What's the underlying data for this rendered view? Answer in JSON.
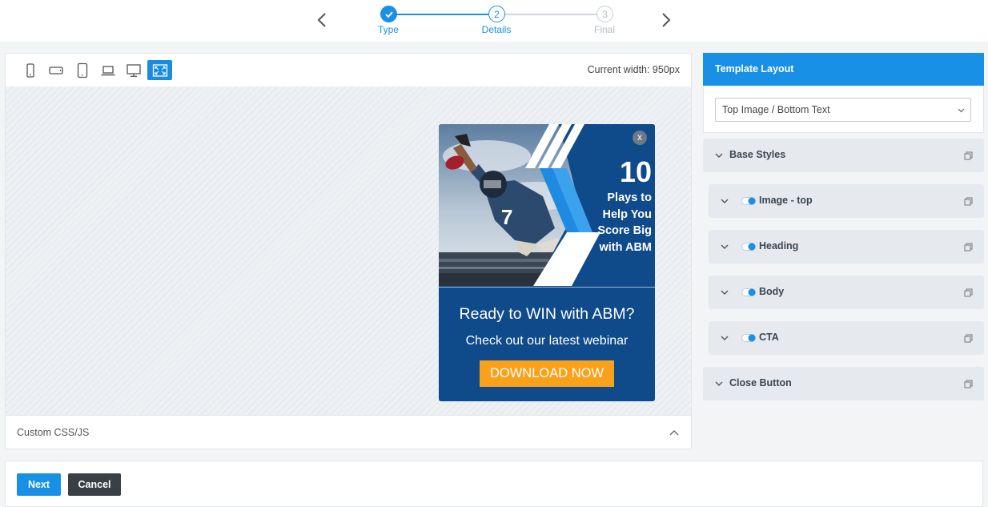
{
  "stepper": {
    "steps": [
      {
        "number": "1",
        "label": "Type",
        "state": "done"
      },
      {
        "number": "2",
        "label": "Details",
        "state": "active"
      },
      {
        "number": "3",
        "label": "Final",
        "state": "upcoming"
      }
    ],
    "prev_icon": "chevron-left-icon",
    "next_icon": "chevron-right-icon"
  },
  "preview": {
    "device_buttons": [
      {
        "name": "mobile-portrait",
        "icon": "mobile-portrait-icon"
      },
      {
        "name": "mobile-landscape",
        "icon": "mobile-landscape-icon"
      },
      {
        "name": "tablet",
        "icon": "tablet-icon"
      },
      {
        "name": "laptop",
        "icon": "laptop-icon"
      },
      {
        "name": "desktop",
        "icon": "desktop-icon"
      },
      {
        "name": "fullscreen",
        "icon": "expand-icon",
        "active": true
      }
    ],
    "current_width": "Current width: 950px",
    "custom_css_label": "Custom CSS/JS"
  },
  "popup": {
    "close_label": "x",
    "big_number": "10",
    "image_text_lines": [
      "Plays to",
      "Help You",
      "Score Big",
      "with ABM"
    ],
    "jersey_number": "7",
    "heading": "Ready to WIN with ABM?",
    "body": "Check out our latest webinar",
    "cta": "DOWNLOAD NOW"
  },
  "template_layout": {
    "title": "Template Layout",
    "selected": "Top Image / Bottom Text"
  },
  "sections": [
    {
      "label": "Base Styles",
      "toggle": false
    },
    {
      "label": "Image - top",
      "toggle": true
    },
    {
      "label": "Heading",
      "toggle": true
    },
    {
      "label": "Body",
      "toggle": true
    },
    {
      "label": "CTA",
      "toggle": true
    },
    {
      "label": "Close Button",
      "toggle": false
    }
  ],
  "footer": {
    "next_label": "Next",
    "cancel_label": "Cancel"
  },
  "colors": {
    "accent": "#1890e6",
    "popup_bg": "#0f4a8a",
    "cta_bg": "#f9a11b",
    "cancel_bg": "#3a4046"
  }
}
